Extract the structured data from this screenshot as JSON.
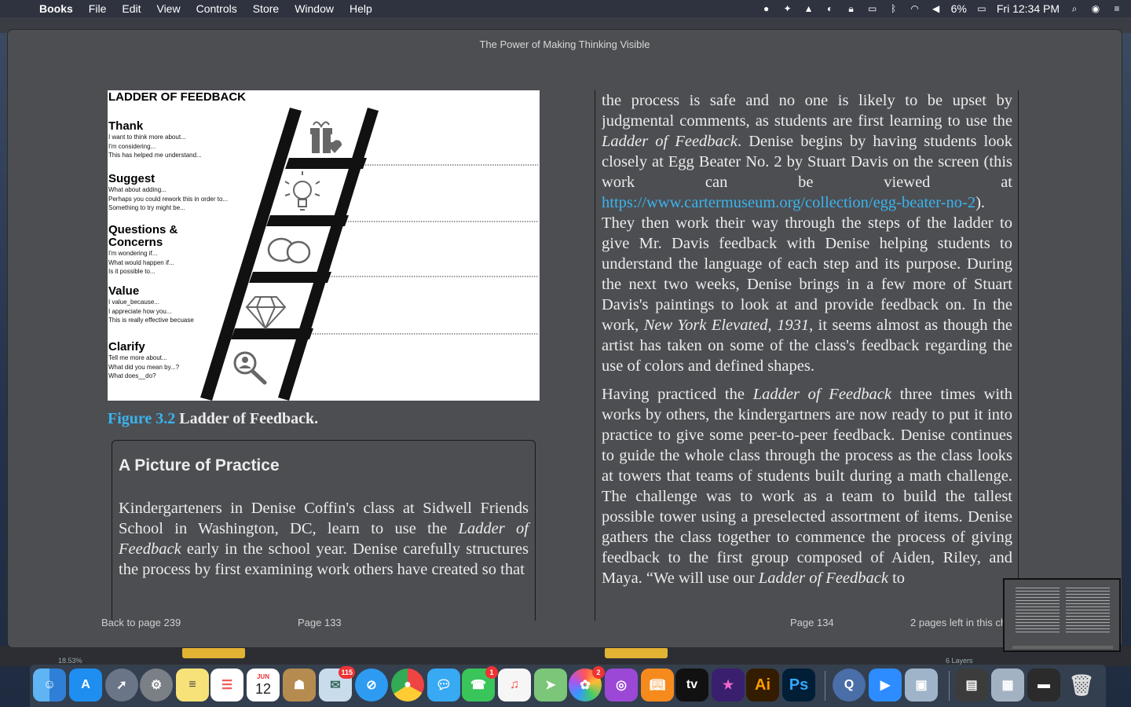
{
  "menubar": {
    "apple_glyph": "",
    "items": [
      "Books",
      "File",
      "Edit",
      "View",
      "Controls",
      "Store",
      "Window",
      "Help"
    ],
    "battery": "6%",
    "clock": "Fri 12:34 PM"
  },
  "window": {
    "title": "The Power of Making Thinking Visible"
  },
  "figure": {
    "heading": "LADDER OF FEEDBACK",
    "rungs": [
      {
        "title": "Thank",
        "lines": [
          "I want to think more about...",
          "I'm considering...",
          "This has helped me understand..."
        ]
      },
      {
        "title": "Suggest",
        "lines": [
          "What about adding...",
          "Perhaps you could rework this in order to...",
          "Something to try might be..."
        ]
      },
      {
        "title": "Questions &",
        "title2": "Concerns",
        "lines": [
          "I'm wondering if...",
          "What would happen if...",
          "Is it possible to..."
        ]
      },
      {
        "title": "Value",
        "lines": [
          "I value_because...",
          "I appreciate how you...",
          "This is really effective becuase"
        ]
      },
      {
        "title": "Clarify",
        "lines": [
          "Tell me more about...",
          "What did you mean by...?",
          "What does__do?"
        ]
      }
    ],
    "caption_number": "Figure 3.2",
    "caption_text": " Ladder of Feedback."
  },
  "practice": {
    "title": "A Picture of Practice",
    "text_parts": [
      "Kindergarteners in Denise Coffin's class at Sidwell Friends School in Washington, DC, learn to use the ",
      "Ladder of Feedback",
      " early in the school year. Denise carefully structures the process by first examining work others have created so that"
    ]
  },
  "right_page": {
    "p1": [
      "the process is safe and no one is likely to be upset by judgmental comments, as students are first learning to use the ",
      "Ladder of Feedback",
      ". Denise begins by having students look closely at Egg Beater No. 2 by Stuart Davis on the screen (this work can be viewed at ",
      "https://www.cartermuseum.org/collection/egg-beater-no-2",
      "). They then work their way through the steps of the ladder to give Mr. Davis feedback with Denise helping students to understand the language of each step and its purpose. During the next two weeks, Denise brings in a few more of Stuart Davis's paintings to look at and provide feedback on. In the work, ",
      "New York Elevated, 1931",
      ", it seems almost as though the artist has taken on some of the class's feedback regarding the use of colors and defined shapes."
    ],
    "p2": [
      "Having practiced the ",
      "Ladder of Feedback",
      " three times with works by others, the kindergartners are now ready to put it into practice to give some peer-to-peer feedback. Denise continues to guide the whole class through the process as the class looks at towers that teams of students built during a math challenge. The challenge was to work as a team to build the tallest possible tower using a preselected assortment of items. Denise gathers the class together to commence the process of giving feedback to the first group composed of Aiden, Riley, and Maya. “We will use our ",
      "Ladder of Feedback",
      " to"
    ]
  },
  "footer": {
    "back": "Back to page 239",
    "page_left": "Page 133",
    "page_right": "Page 134",
    "pages_left": "2 pages left in this ch"
  },
  "background_app": {
    "zoom": "18.53%",
    "layers": "6 Layers"
  },
  "dock": {
    "calendar_month": "JUN",
    "calendar_day": "12",
    "badge_mail": "115",
    "badge_facetime": "1",
    "badge_photos": "2",
    "tv_label": "tv",
    "ai_label": "Ai",
    "ps_label": "Ps"
  }
}
